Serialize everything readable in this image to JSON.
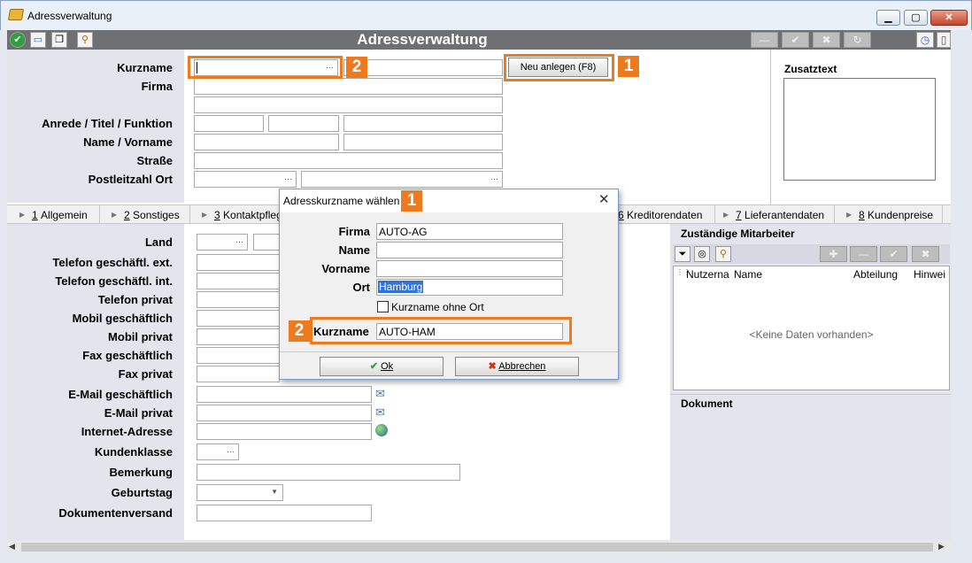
{
  "window": {
    "title": "Adressverwaltung",
    "min_label": "▁",
    "max_label": "▢",
    "close_label": "✕"
  },
  "toolbar": {
    "title": "Adressverwaltung",
    "right_icons": [
      "minus-icon",
      "check-icon",
      "cross-icon",
      "undo-icon",
      "clock-icon",
      "book-icon"
    ]
  },
  "form": {
    "kurzname_label": "Kurzname",
    "firma_label": "Firma",
    "anrede_label": "Anrede / Titel / Funktion",
    "name_label": "Name / Vorname",
    "strasse_label": "Straße",
    "plz_label": "Postleitzahl Ort",
    "neu_anlegen_button": "Neu anlegen (F8)",
    "zusatztext_label": "Zusatztext",
    "dots": "···"
  },
  "tabs": [
    {
      "num": "1",
      "label": "Allgemein"
    },
    {
      "num": "2",
      "label": "Sonstiges"
    },
    {
      "num": "3",
      "label": "Kontaktpfleg"
    },
    {
      "num": "6",
      "label": "Kreditorendaten"
    },
    {
      "num": "7",
      "label": "Lieferantendaten"
    },
    {
      "num": "8",
      "label": "Kundenpreise"
    }
  ],
  "general": {
    "land": "Land",
    "tel_ext": "Telefon geschäftl. ext.",
    "tel_int": "Telefon geschäftl. int.",
    "tel_privat": "Telefon privat",
    "mobil_geschaeft": "Mobil geschäftlich",
    "mobil_privat": "Mobil privat",
    "fax_geschaeft": "Fax geschäftlich",
    "fax_privat": "Fax privat",
    "email_geschaeft": "E-Mail geschäftlich",
    "email_privat": "E-Mail privat",
    "internet": "Internet-Adresse",
    "kundenklasse": "Kundenklasse",
    "bemerkung": "Bemerkung",
    "geburtstag": "Geburtstag",
    "dokumentenversand": "Dokumentenversand"
  },
  "mitarbeiter": {
    "title": "Zuständige Mitarbeiter",
    "columns": [
      "Nutzerna",
      "Name",
      "Abteilung",
      "Hinwei"
    ],
    "empty": "<Keine Daten vorhanden>",
    "dokument_title": "Dokument"
  },
  "dialog": {
    "title": "Adresskurzname wählen",
    "firma_label": "Firma",
    "firma_value": "AUTO-AG",
    "name_label": "Name",
    "name_value": "",
    "vorname_label": "Vorname",
    "vorname_value": "",
    "ort_label": "Ort",
    "ort_value": "Hamburg",
    "checkbox_label": "Kurzname ohne Ort",
    "kurzname_label": "Kurzname",
    "kurzname_value": "AUTO-HAM",
    "ok_label": "Ok",
    "cancel_label": "Abbrechen"
  },
  "annotations": {
    "one": "1",
    "two": "2"
  },
  "colors": {
    "accent": "#ee7a1e",
    "toolbar": "#6f7074",
    "panel": "#e4e4ec"
  }
}
